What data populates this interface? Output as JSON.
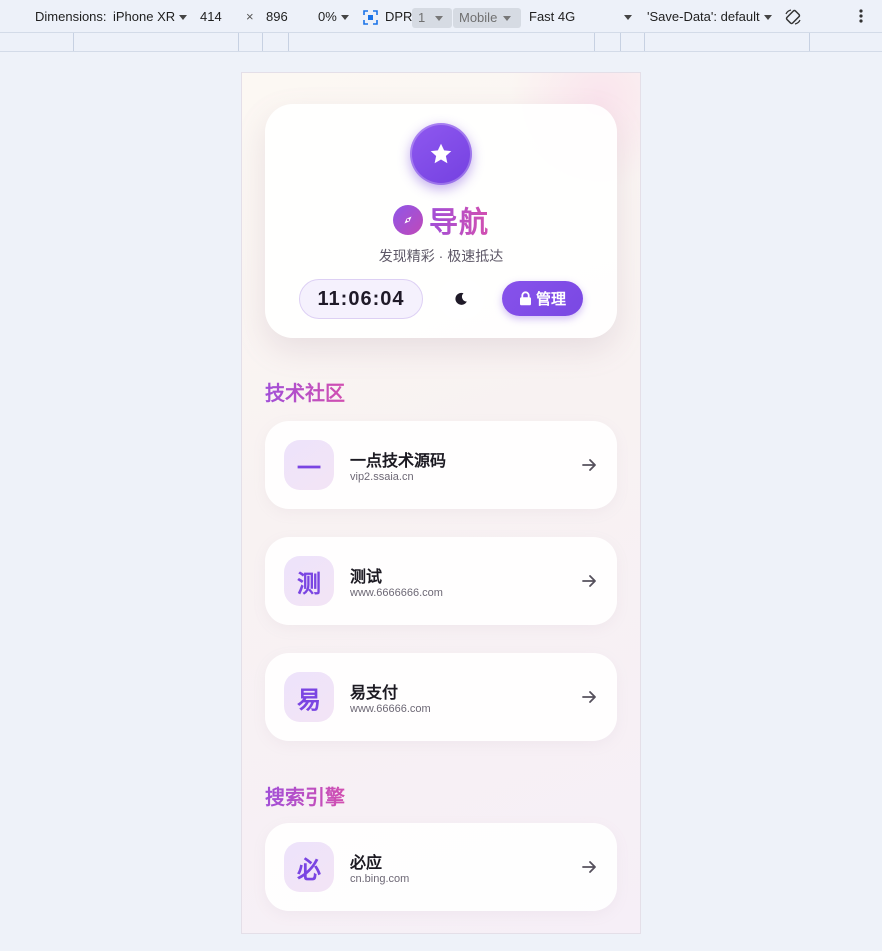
{
  "devtools": {
    "dimensions_label": "Dimensions:",
    "device": "iPhone XR",
    "width": "414",
    "times": "×",
    "height": "896",
    "zoom": "0%",
    "dpr_label": "DPR:",
    "dpr_value": "1",
    "mode": "Mobile",
    "network": "Fast 4G",
    "save_data": "'Save-Data': default"
  },
  "hero": {
    "title": "导航",
    "subtitle": "发现精彩 · 极速抵达",
    "clock": "11:06:04",
    "admin_label": "管理"
  },
  "sections": [
    {
      "title": "技术社区",
      "items": [
        {
          "badge": "一",
          "name": "一点技术源码",
          "url": "vip2.ssaia.cn"
        },
        {
          "badge": "测",
          "name": "测试",
          "url": "www.6666666.com"
        },
        {
          "badge": "易",
          "name": "易支付",
          "url": "www.66666.com"
        }
      ]
    },
    {
      "title": "搜索引擎",
      "items": [
        {
          "badge": "必",
          "name": "必应",
          "url": "cn.bing.com"
        }
      ]
    }
  ],
  "colors": {
    "accent": "#7a48e3",
    "title_gradient_start": "#a14fd8",
    "title_gradient_end": "#d24fb0"
  }
}
